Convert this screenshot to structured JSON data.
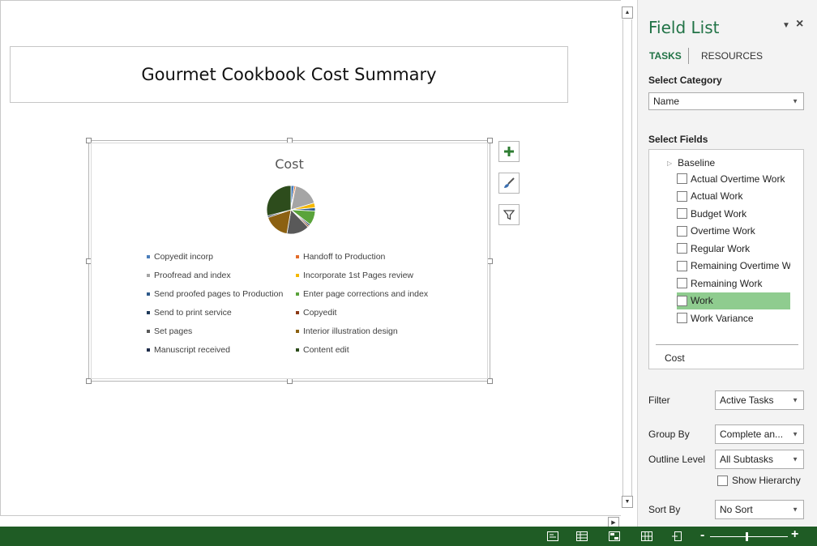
{
  "report": {
    "title": "Gourmet Cookbook Cost Summary"
  },
  "chart_data": {
    "type": "pie",
    "title": "Cost",
    "legend_position": "bottom",
    "series": [
      {
        "name": "Cost",
        "slices": [
          {
            "label": "Copyedit incorp",
            "color": "#4a7ebb",
            "value": 2
          },
          {
            "label": "Handoff to Production",
            "color": "#e46c2a",
            "value": 1
          },
          {
            "label": "Proofread and index",
            "color": "#a5a5a5",
            "value": 16
          },
          {
            "label": "Incorporate 1st Pages review",
            "color": "#f5b800",
            "value": 3
          },
          {
            "label": "Send proofed pages to Production",
            "color": "#2e5a8a",
            "value": 2
          },
          {
            "label": "Enter page corrections and index",
            "color": "#5aa33b",
            "value": 9
          },
          {
            "label": "Send to print service",
            "color": "#1f3a5a",
            "value": 1
          },
          {
            "label": "Copyedit",
            "color": "#8b3a16",
            "value": 1
          },
          {
            "label": "Set pages",
            "color": "#595959",
            "value": 14
          },
          {
            "label": "Interior illustration design",
            "color": "#8c6112",
            "value": 16
          },
          {
            "label": "Manuscript received",
            "color": "#1f2c4a",
            "value": 1
          },
          {
            "label": "Content edit",
            "color": "#2d4c1c",
            "value": 27
          }
        ]
      }
    ]
  },
  "chart_tools": {
    "add_element_icon": "plus-icon",
    "style_icon": "brush-icon",
    "filter_icon": "funnel-icon"
  },
  "field_list": {
    "title": "Field List",
    "menu_glyph": "▼",
    "close_glyph": "×",
    "tabs": {
      "tasks": "TASKS",
      "resources": "RESOURCES"
    },
    "select_category_label": "Select Category",
    "category_value": "Name",
    "select_fields_label": "Select Fields",
    "group_name": "Baseline",
    "fields": [
      {
        "label": "Actual Overtime Work",
        "selected": false
      },
      {
        "label": "Actual Work",
        "selected": false
      },
      {
        "label": "Budget Work",
        "selected": false
      },
      {
        "label": "Overtime Work",
        "selected": false
      },
      {
        "label": "Regular Work",
        "selected": false
      },
      {
        "label": "Remaining Overtime W",
        "selected": false
      },
      {
        "label": "Remaining Work",
        "selected": false
      },
      {
        "label": "Work",
        "selected": true
      },
      {
        "label": "Work Variance",
        "selected": false
      }
    ],
    "chosen_field": "Cost",
    "filter_label": "Filter",
    "filter_value": "Active Tasks",
    "group_by_label": "Group By",
    "group_by_value": "Complete an...",
    "outline_level_label": "Outline Level",
    "outline_level_value": "All Subtasks",
    "show_hierarchy_label": "Show Hierarchy",
    "sort_by_label": "Sort By",
    "sort_by_value": "No Sort"
  },
  "status_bar": {
    "background": "#1f5c25",
    "zoom_minus": "-",
    "zoom_plus": "+",
    "zoom_level": 0.45,
    "view_icons": [
      "normal-view-icon",
      "gantt-view-icon",
      "task-usage-icon",
      "team-planner-icon",
      "report-view-icon"
    ]
  }
}
